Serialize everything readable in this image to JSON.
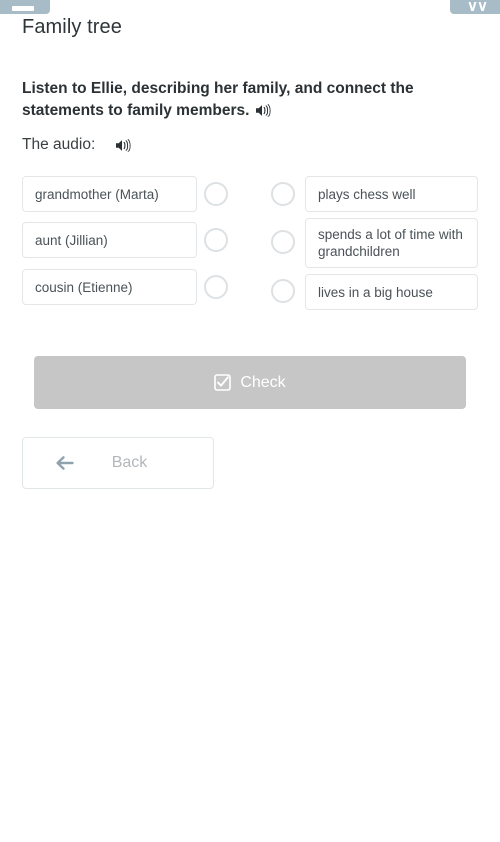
{
  "chrome": {
    "left_button": {
      "name": "menu-button",
      "glyph": "—"
    },
    "right_button": {
      "name": "collapse-button",
      "glyph": "∨∨"
    }
  },
  "header": {
    "title": "Family tree"
  },
  "instructions": {
    "text": "Listen to Ellie, describing her family, and connect the statements to family members.",
    "speaker_icon": "speaker-icon"
  },
  "audio": {
    "label": "The audio:",
    "speaker_icon": "speaker-icon"
  },
  "match": {
    "left_items": [
      {
        "label": "grandmother (Marta)"
      },
      {
        "label": "aunt (Jillian)"
      },
      {
        "label": "cousin (Etienne)"
      }
    ],
    "right_items": [
      {
        "label": "plays chess well"
      },
      {
        "label": "spends a lot of time with grandchildren"
      },
      {
        "label": "lives in a big house"
      }
    ]
  },
  "actions": {
    "check_label": "Check",
    "check_icon": "checkbox-checked-icon",
    "back_label": "Back",
    "back_icon": "arrow-left-icon"
  },
  "colors": {
    "chrome": "#a7bcc6",
    "box_border": "#e3e7e9",
    "circle_border": "#dde1e4",
    "check_disabled_bg": "#c6c6c6",
    "back_text": "#b3b7ba",
    "back_arrow": "#8fa3ae",
    "title_text": "#2e3538"
  }
}
